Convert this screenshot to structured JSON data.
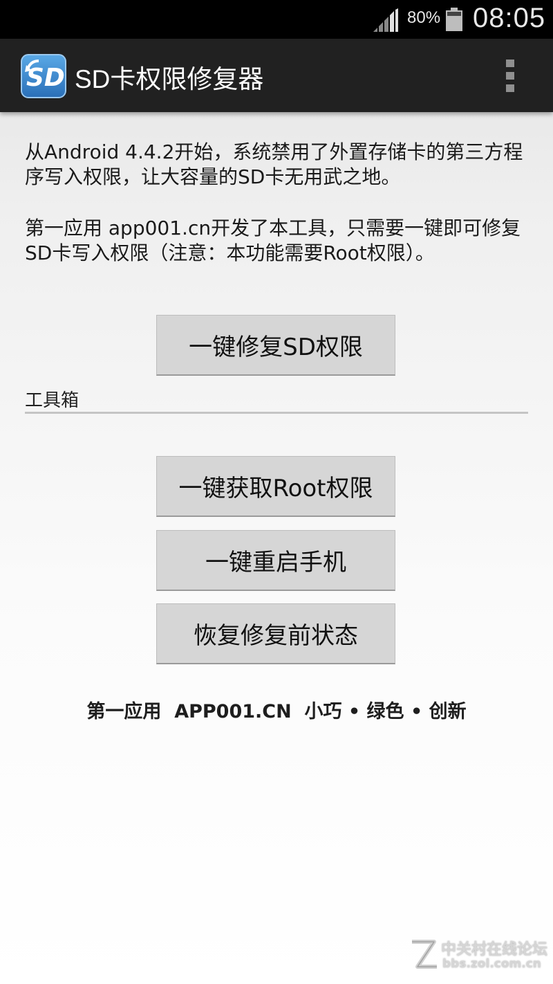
{
  "status_bar": {
    "battery_percent": "80%",
    "time": "08:05",
    "signal_icon": "cell-signal-icon",
    "battery_icon": "battery-icon",
    "battery_level": 0.8
  },
  "action_bar": {
    "title": "SD卡权限修复器",
    "logo_icon": "sd-card-logo-icon",
    "overflow_icon": "more-vert-icon"
  },
  "intro": {
    "paragraph1": "从Android 4.4.2开始，系统禁用了外置存储卡的第三方程序写入权限，让大容量的SD卡无用武之地。",
    "paragraph2": "第一应用 app001.cn开发了本工具，只需要一键即可修复SD卡写入权限（注意：本功能需要Root权限）。"
  },
  "primary_button": "一键修复SD权限",
  "toolbox": {
    "label": "工具箱",
    "buttons": [
      "一键获取Root权限",
      "一键重启手机",
      "恢复修复前状态"
    ]
  },
  "footer": "第一应用  APP001.CN  小巧 • 绿色 • 创新",
  "watermark": {
    "title": "中关村在线论坛",
    "url": "bbs.zol.com.cn"
  }
}
